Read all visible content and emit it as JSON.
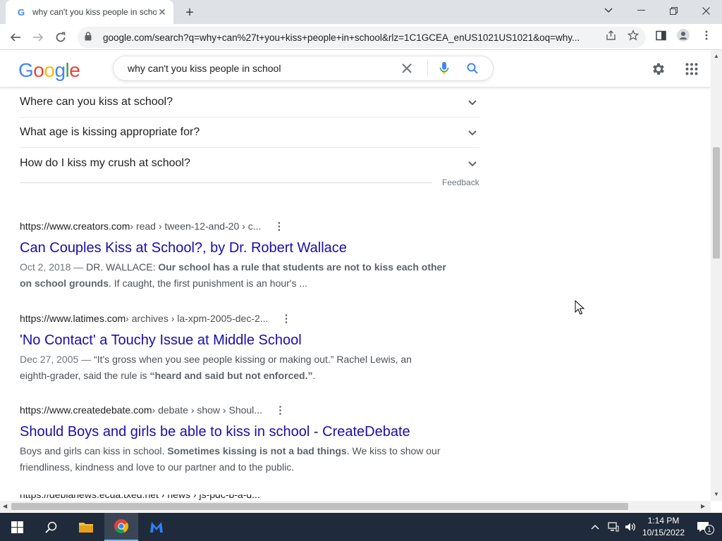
{
  "browser": {
    "tab_title": "why can't you kiss people in scho",
    "url": "google.com/search?q=why+can%27t+you+kiss+people+in+school&rlz=1C1GCEA_enUS1021US1021&oq=why..."
  },
  "google": {
    "logo": [
      "G",
      "o",
      "o",
      "g",
      "l",
      "e"
    ],
    "logo_colors": [
      "#4285F4",
      "#EA4335",
      "#FBBC05",
      "#4285F4",
      "#34A853",
      "#EA4335"
    ],
    "query": "why can't you kiss people in school"
  },
  "faqs": [
    {
      "question": "Where can you kiss at school?"
    },
    {
      "question": "What age is kissing appropriate for?"
    },
    {
      "question": "How do I kiss my crush at school?"
    }
  ],
  "feedback_label": "Feedback",
  "results": [
    {
      "domain": "https://www.creators.com",
      "path": " › read › tween-12-and-20 › c...",
      "title": "Can Couples Kiss at School?, by Dr. Robert Wallace",
      "date": "Oct 2, 2018 — ",
      "snippet_a": "DR. WALLACE: ",
      "snippet_b": "Our school has a rule that students are not to kiss each other on school grounds",
      "snippet_c": ". If caught, the first punishment is an hour's ..."
    },
    {
      "domain": "https://www.latimes.com",
      "path": " › archives › la-xpm-2005-dec-2...",
      "title": "'No Contact' a Touchy Issue at Middle School",
      "date": "Dec 27, 2005 — ",
      "snippet_a": "“It's gross when you see people kissing or making out.” Rachel Lewis, an eighth-grader, said the rule is ",
      "snippet_b": "“heard and said but not enforced.”",
      "snippet_c": "."
    },
    {
      "domain": "https://www.createdebate.com",
      "path": " › debate › show › Shoul...",
      "title": "Should Boys and girls be able to kiss in school - CreateDebate",
      "date": "",
      "snippet_a": "Boys and girls can kiss in school. ",
      "snippet_b": "Sometimes kissing is not a bad things",
      "snippet_c": ". We kiss to show our friendliness, kindness and love to our partner and to the public."
    }
  ],
  "partial_result_cite": "https://debianews.ecua.txed.net › news › js-pdc-b-a-d...",
  "taskbar": {
    "time": "1:14 PM",
    "date": "10/15/2022",
    "notification_count": "1"
  }
}
